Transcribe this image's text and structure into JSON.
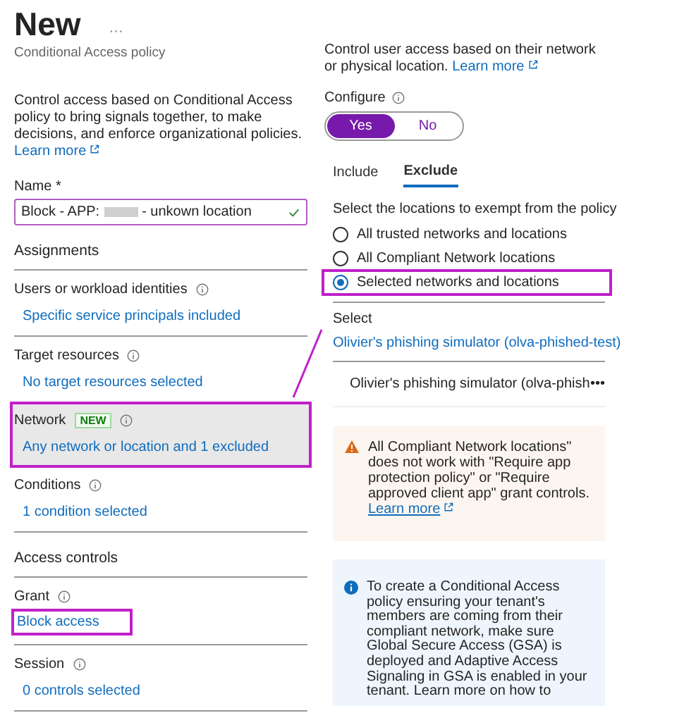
{
  "header": {
    "title": "New",
    "more": "···",
    "subtitle": "Conditional Access policy"
  },
  "left": {
    "description": "Control access based on Conditional Access policy to bring signals together, to make decisions, and enforce organizational policies.",
    "learn_more": "Learn more",
    "name_field": {
      "label": "Name *",
      "value_start": "Block - APP:",
      "value_end": "- unkown location",
      "valid": true
    },
    "groups": [
      {
        "heading": "Assignments",
        "items": [
          {
            "label": "Users or workload identities",
            "value": "Specific service principals included",
            "highlighted": false,
            "value_highlighted": false
          },
          {
            "label": "Target resources",
            "value": "No target resources selected",
            "highlighted": false,
            "value_highlighted": false
          },
          {
            "label": "Network",
            "value": "Any network or location and 1 excluded",
            "badge": "NEW",
            "highlighted": true,
            "value_highlighted": false
          },
          {
            "label": "Conditions",
            "value": "1 condition selected",
            "highlighted": false,
            "value_highlighted": false
          }
        ]
      },
      {
        "heading": "Access controls",
        "items": [
          {
            "label": "Grant",
            "value": "Block access",
            "highlighted": false,
            "value_highlighted": true
          },
          {
            "label": "Session",
            "value": "0 controls selected",
            "highlighted": false,
            "value_highlighted": false
          }
        ]
      }
    ]
  },
  "right": {
    "description": "Control user access based on their network or physical location.",
    "learn_more": "Learn more",
    "configure": {
      "label": "Configure",
      "options": [
        {
          "label": "Yes",
          "selected": true
        },
        {
          "label": "No",
          "selected": false
        }
      ]
    },
    "tabs": [
      {
        "label": "Include",
        "selected": false
      },
      {
        "label": "Exclude",
        "selected": true
      }
    ],
    "prompt": "Select the locations to exempt from the policy",
    "options": [
      {
        "label": "All trusted networks and locations",
        "selected": false,
        "highlighted": false
      },
      {
        "label": "All Compliant Network locations",
        "selected": false,
        "highlighted": false
      },
      {
        "label": "Selected networks and locations",
        "selected": true,
        "highlighted": true
      }
    ],
    "select": {
      "label": "Select",
      "link": "Olivier's phishing simulator (olva-phished-test)",
      "item": "Olivier's phishing simulator (olva-phish",
      "more": "•••"
    },
    "warning": {
      "text": "All Compliant Network locations\" does not work with \"Require app protection policy\" or \"Require approved client app\" grant controls.",
      "link": "Learn more"
    },
    "info": {
      "text": "To create a Conditional Access policy ensuring your tenant's members are coming from their compliant network, make sure Global Secure Access (GSA) is deployed and Adaptive Access Signaling in GSA is enabled in your tenant. Learn more on how to"
    }
  }
}
